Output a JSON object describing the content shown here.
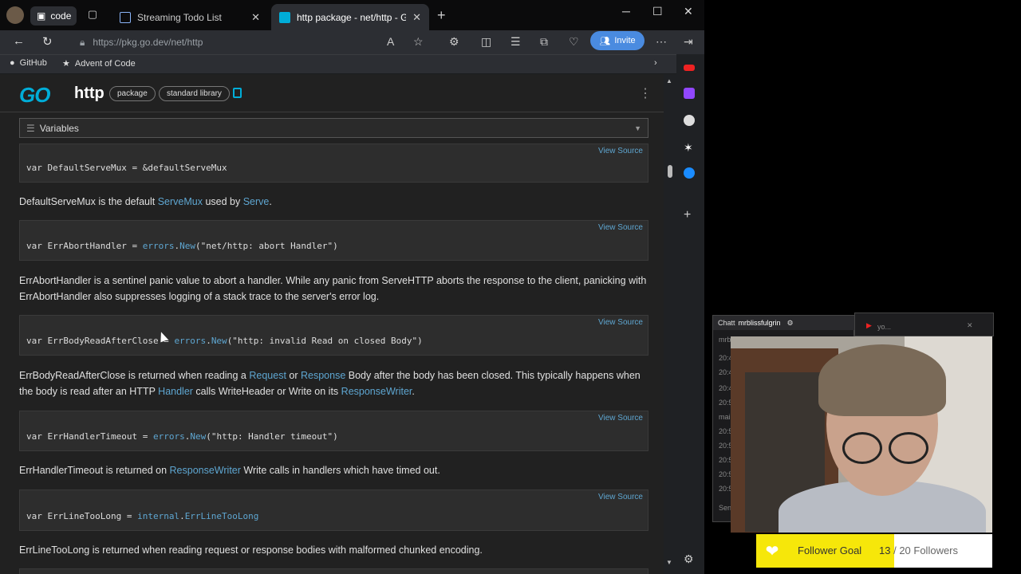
{
  "browser": {
    "workspace_label": "code",
    "tabs": [
      {
        "label": "Streaming Todo List",
        "active": false
      },
      {
        "label": "http package - net/http - Go Pac",
        "active": true
      }
    ],
    "url": "https://pkg.go.dev/net/http",
    "invite_label": "Invite",
    "bookmarks": [
      "GitHub",
      "Advent of Code"
    ]
  },
  "page": {
    "logo": "GO",
    "package_name": "http",
    "chips": [
      "package",
      "standard library"
    ],
    "section_dropdown": "Variables",
    "view_source_label": "View Source",
    "blocks": [
      {
        "code": "var DefaultServeMux = &defaultServeMux",
        "description": [
          {
            "text": "DefaultServeMux is the default ",
            "link": false
          },
          {
            "text": "ServeMux",
            "link": true
          },
          {
            "text": " used by ",
            "link": false
          },
          {
            "text": "Serve",
            "link": true
          },
          {
            "text": ".",
            "link": false
          }
        ]
      },
      {
        "code_parts": [
          {
            "text": "var ErrAbortHandler = ",
            "link": false
          },
          {
            "text": "errors",
            "link": true
          },
          {
            "text": ".",
            "link": false
          },
          {
            "text": "New",
            "link": true
          },
          {
            "text": "(\"net/http: abort Handler\")",
            "link": false
          }
        ],
        "description": [
          {
            "text": "ErrAbortHandler is a sentinel panic value to abort a handler. While any panic from ServeHTTP aborts the response to the client, panicking with ErrAbortHandler also suppresses logging of a stack trace to the server's error log.",
            "link": false
          }
        ]
      },
      {
        "code_parts": [
          {
            "text": "var ErrBodyReadAfterClose = ",
            "link": false
          },
          {
            "text": "errors",
            "link": true
          },
          {
            "text": ".",
            "link": false
          },
          {
            "text": "New",
            "link": true
          },
          {
            "text": "(\"http: invalid Read on closed Body\")",
            "link": false
          }
        ],
        "description": [
          {
            "text": "ErrBodyReadAfterClose is returned when reading a ",
            "link": false
          },
          {
            "text": "Request",
            "link": true
          },
          {
            "text": " or ",
            "link": false
          },
          {
            "text": "Response",
            "link": true
          },
          {
            "text": " Body after the body has been closed. This typically happens when the body is read after an HTTP ",
            "link": false
          },
          {
            "text": "Handler",
            "link": true
          },
          {
            "text": " calls WriteHeader or Write on its ",
            "link": false
          },
          {
            "text": "ResponseWriter",
            "link": true
          },
          {
            "text": ".",
            "link": false
          }
        ]
      },
      {
        "code_parts": [
          {
            "text": "var ErrHandlerTimeout = ",
            "link": false
          },
          {
            "text": "errors",
            "link": true
          },
          {
            "text": ".",
            "link": false
          },
          {
            "text": "New",
            "link": true
          },
          {
            "text": "(\"http: Handler timeout\")",
            "link": false
          }
        ],
        "description": [
          {
            "text": "ErrHandlerTimeout is returned on ",
            "link": false
          },
          {
            "text": "ResponseWriter",
            "link": true
          },
          {
            "text": " Write calls in handlers which have timed out.",
            "link": false
          }
        ]
      },
      {
        "code_parts": [
          {
            "text": "var ErrLineTooLong = ",
            "link": false
          },
          {
            "text": "internal",
            "link": true
          },
          {
            "text": ".",
            "link": false
          },
          {
            "text": "ErrLineTooLong",
            "link": true
          }
        ],
        "description": [
          {
            "text": "ErrLineTooLong is returned when reading request or response bodies with malformed chunked encoding.",
            "link": false
          }
        ]
      }
    ]
  },
  "overlay": {
    "chat_title": "Chatt",
    "chat_user": "mrblissfulgrin",
    "chat_lines": [
      "mrb",
      "20:4",
      "20:4",
      "20:4",
      "20:5",
      "mai",
      "20:5",
      "20:5",
      "20:5",
      "20:5",
      "20:5"
    ],
    "chat_input_placeholder": "Sen",
    "yt_title": "yo...",
    "goal_label": "Follower Goal",
    "goal_current": "13",
    "goal_total_text": "/ 20 Followers",
    "goal_fraction": 0.65
  }
}
